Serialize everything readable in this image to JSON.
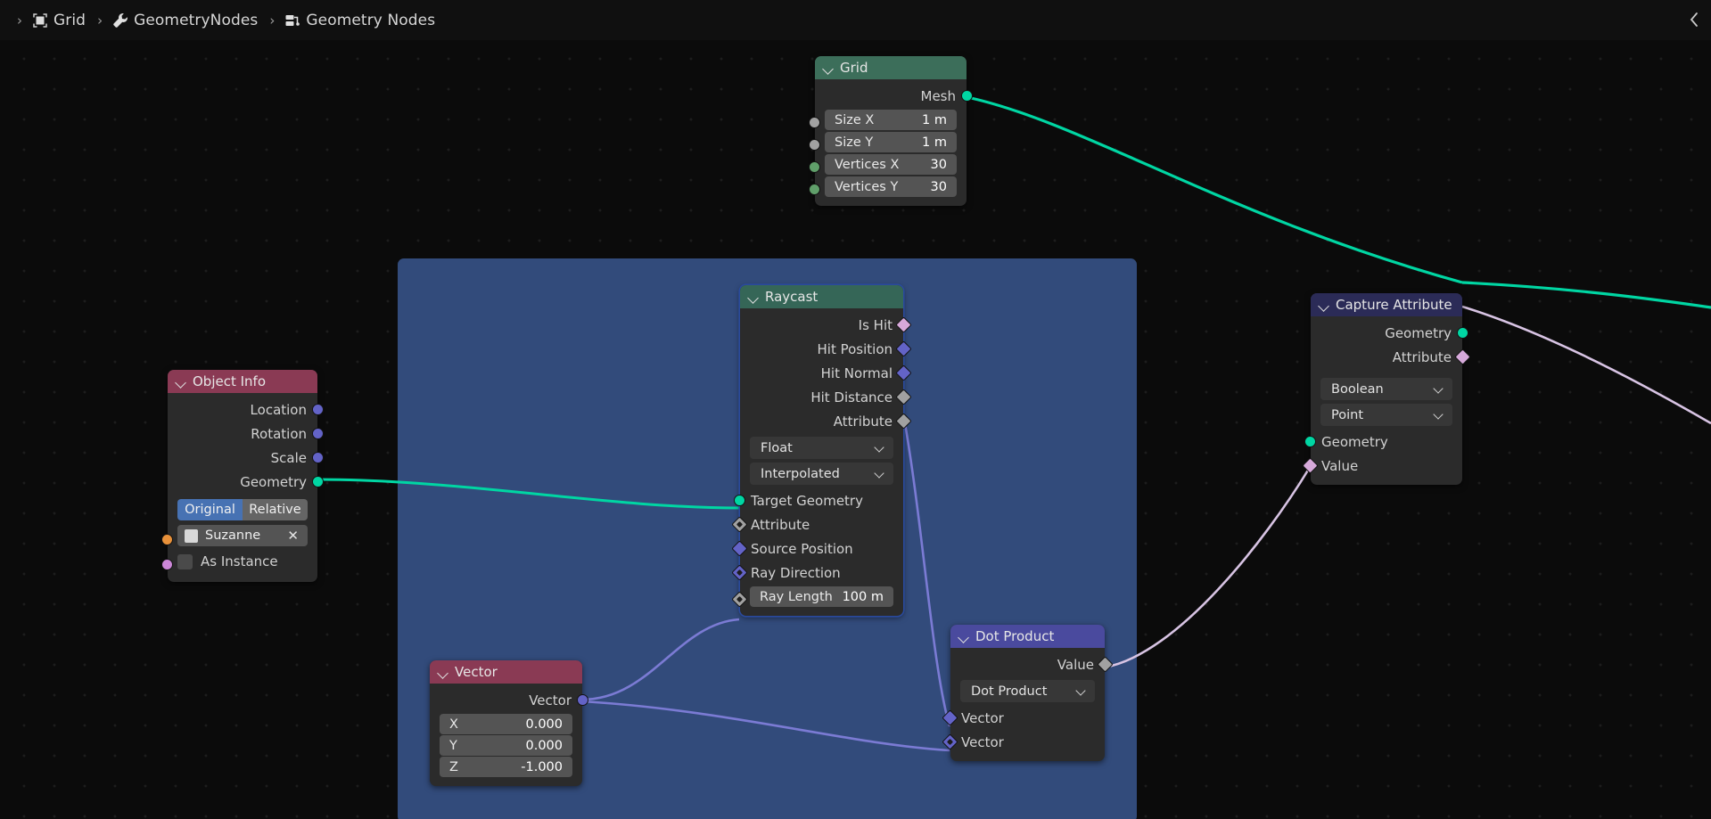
{
  "app": {
    "editor": "Geometry Node Editor",
    "background_color": "#0b0b0b",
    "selection_box_color": "#324b7b"
  },
  "header": {
    "breadcrumb": [
      {
        "icon": "object-icon",
        "label": "Grid"
      },
      {
        "icon": "modifier-wrench-icon",
        "label": "GeometryNodes"
      },
      {
        "icon": "geometry-nodes-icon",
        "label": "Geometry Nodes"
      }
    ],
    "separator": "›",
    "sidebar_toggle_icon": "chevron-left-icon"
  },
  "nodes": [
    {
      "id": "grid",
      "title": "Grid",
      "header_color": "#3c6e5a",
      "outputs": [
        {
          "label": "Mesh",
          "socket": "geometry",
          "color": "#00d6a3",
          "shape": "round"
        }
      ],
      "properties": [
        {
          "name": "Size X",
          "value": "1 m",
          "socket_color": "#a1a1a1",
          "shape": "round"
        },
        {
          "name": "Size Y",
          "value": "1 m",
          "socket_color": "#a1a1a1",
          "shape": "round"
        },
        {
          "name": "Vertices X",
          "value": "30",
          "socket_color": "#609f6a",
          "shape": "round"
        },
        {
          "name": "Vertices Y",
          "value": "30",
          "socket_color": "#609f6a",
          "shape": "round"
        }
      ]
    },
    {
      "id": "object-info",
      "title": "Object Info",
      "header_color": "#8a3a54",
      "outputs": [
        {
          "label": "Location",
          "color": "#6363c7",
          "shape": "round"
        },
        {
          "label": "Rotation",
          "color": "#6363c7",
          "shape": "round"
        },
        {
          "label": "Scale",
          "color": "#6363c7",
          "shape": "round"
        },
        {
          "label": "Geometry",
          "color": "#00d6a3",
          "shape": "round"
        }
      ],
      "transform_space": {
        "options": [
          "Original",
          "Relative"
        ],
        "selected": "Original"
      },
      "object_field": {
        "value": "Suzanne",
        "icon": "mesh-data-icon",
        "clear_icon": "x-icon",
        "socket_color": "#e8913a"
      },
      "as_instance": {
        "label": "As Instance",
        "checked": false,
        "socket_color": "#cc87d8"
      }
    },
    {
      "id": "raycast",
      "title": "Raycast",
      "header_color": "#356657",
      "selected": true,
      "outputs": [
        {
          "label": "Is Hit",
          "color": "#d6a9da",
          "shape": "diamond"
        },
        {
          "label": "Hit Position",
          "color": "#6363c7",
          "shape": "diamond"
        },
        {
          "label": "Hit Normal",
          "color": "#6363c7",
          "shape": "diamond"
        },
        {
          "label": "Hit Distance",
          "color": "#a1a1a1",
          "shape": "diamond"
        },
        {
          "label": "Attribute",
          "color": "#a1a1a1",
          "shape": "diamond"
        }
      ],
      "dropdowns": [
        {
          "name": "data-type",
          "value": "Float"
        },
        {
          "name": "mapping",
          "value": "Interpolated"
        }
      ],
      "inputs": [
        {
          "label": "Target Geometry",
          "color": "#00d6a3",
          "shape": "round"
        },
        {
          "label": "Attribute",
          "color": "#a1a1a1",
          "shape": "dot-diamond"
        },
        {
          "label": "Source Position",
          "color": "#6363c7",
          "shape": "diamond"
        },
        {
          "label": "Ray Direction",
          "color": "#6363c7",
          "shape": "dot-diamond"
        }
      ],
      "properties": [
        {
          "name": "Ray Length",
          "value": "100 m",
          "socket_color": "#a1a1a1",
          "shape": "dot-diamond"
        }
      ]
    },
    {
      "id": "vector",
      "title": "Vector",
      "header_color": "#8a3a54",
      "outputs": [
        {
          "label": "Vector",
          "color": "#6363c7",
          "shape": "round"
        }
      ],
      "values": [
        {
          "name": "X",
          "value": "0.000"
        },
        {
          "name": "Y",
          "value": "0.000"
        },
        {
          "name": "Z",
          "value": "-1.000"
        }
      ]
    },
    {
      "id": "dot-product",
      "title": "Dot Product",
      "header_color": "#4a4a9e",
      "outputs": [
        {
          "label": "Value",
          "color": "#a1a1a1",
          "shape": "diamond"
        }
      ],
      "dropdowns": [
        {
          "name": "operation",
          "value": "Dot Product"
        }
      ],
      "inputs": [
        {
          "label": "Vector",
          "color": "#6363c7",
          "shape": "diamond"
        },
        {
          "label": "Vector",
          "color": "#6363c7",
          "shape": "dot-diamond"
        }
      ]
    },
    {
      "id": "capture-attribute",
      "title": "Capture Attribute",
      "header_color": "#2b2b57",
      "outputs": [
        {
          "label": "Geometry",
          "color": "#00d6a3",
          "shape": "round"
        },
        {
          "label": "Attribute",
          "color": "#d6a9da",
          "shape": "diamond"
        }
      ],
      "dropdowns": [
        {
          "name": "data-type",
          "value": "Boolean"
        },
        {
          "name": "domain",
          "value": "Point"
        }
      ],
      "inputs": [
        {
          "label": "Geometry",
          "color": "#00d6a3",
          "shape": "round"
        },
        {
          "label": "Value",
          "color": "#d6a9da",
          "shape": "diamond"
        }
      ]
    }
  ],
  "links": [
    {
      "from": "grid.Mesh",
      "to": "offscreen-right",
      "color": "#00d6a3"
    },
    {
      "from": "object-info.Geometry",
      "to": "raycast.Target Geometry",
      "color": "#00d6a3"
    },
    {
      "from": "vector.Vector",
      "to": "raycast.Ray Direction",
      "color": "#7b7bd4"
    },
    {
      "from": "vector.Vector",
      "to": "dot-product.Vector2",
      "color": "#7b7bd4"
    },
    {
      "from": "raycast.Hit Normal",
      "to": "dot-product.Vector1",
      "color": "#7b7bd4"
    },
    {
      "from": "dot-product.Value",
      "to": "capture-attribute.Value",
      "color": "#d8c4e4"
    },
    {
      "from": "capture-attribute.Geometry",
      "to": "offscreen-right",
      "color": "#00d6a3"
    },
    {
      "from": "capture-attribute.Attribute",
      "to": "offscreen-right",
      "color": "#d8c4e4"
    }
  ]
}
